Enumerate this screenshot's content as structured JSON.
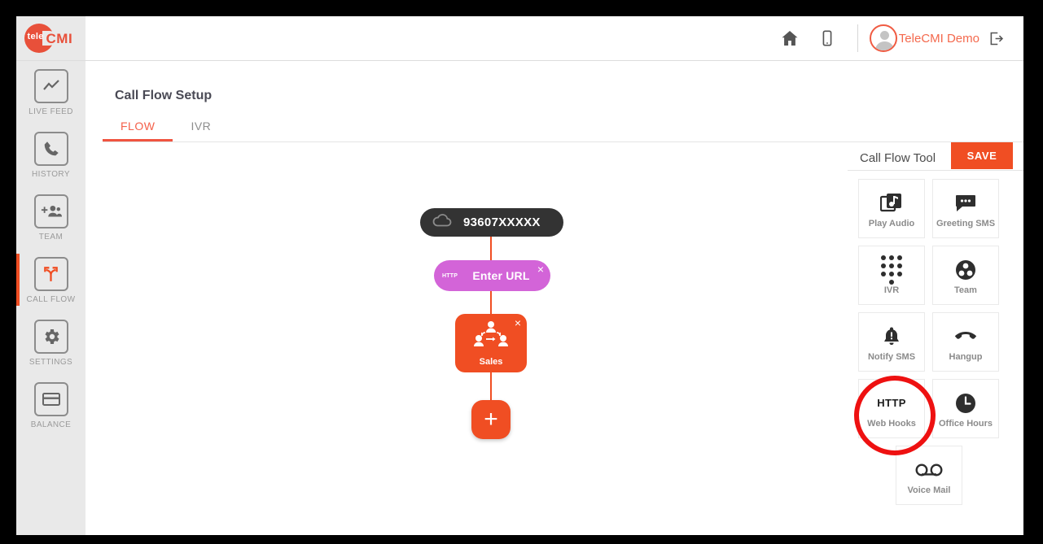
{
  "brand": {
    "logo_tele": "tele",
    "logo_cmi": "CMI",
    "accent": "#f04e23",
    "logo_red": "#e8503a"
  },
  "header": {
    "home_icon": "home-icon",
    "mobile_icon": "mobile-icon",
    "user_name": "TeleCMI Demo",
    "avatar_icon": "avatar-icon",
    "logout_icon": "logout-icon"
  },
  "sidebar": {
    "items": [
      {
        "label": "LIVE FEED",
        "icon": "line-chart-icon",
        "active": false
      },
      {
        "label": "HISTORY",
        "icon": "phone-icon",
        "active": false
      },
      {
        "label": "TEAM",
        "icon": "add-people-icon",
        "active": false
      },
      {
        "label": "CALL FLOW",
        "icon": "call-flow-branch-icon",
        "active": true
      },
      {
        "label": "SETTINGS",
        "icon": "gear-icon",
        "active": false
      },
      {
        "label": "BALANCE",
        "icon": "card-icon",
        "active": false
      }
    ]
  },
  "main": {
    "page_title": "Call Flow Setup",
    "tabs": [
      {
        "label": "FLOW",
        "active": true
      },
      {
        "label": "IVR",
        "active": false
      }
    ]
  },
  "flow": {
    "phone_node": {
      "number": "93607XXXXX",
      "icon": "cloud-icon"
    },
    "url_node": {
      "badge": "HTTP",
      "label": "Enter URL",
      "close": "×",
      "color": "#d364d8"
    },
    "sales_node": {
      "label": "Sales",
      "icon": "team-group-icon",
      "close": "×",
      "color": "#f04e23"
    },
    "add_node": {
      "label": "+"
    }
  },
  "tool_panel": {
    "title": "Call Flow Tool",
    "save_label": "SAVE",
    "tools": [
      {
        "label": "Play Audio",
        "icon": "play-audio-icon"
      },
      {
        "label": "Greeting SMS",
        "icon": "chat-bubble-icon"
      },
      {
        "label": "IVR",
        "icon": "dialpad-icon"
      },
      {
        "label": "Team",
        "icon": "team-circle-icon"
      },
      {
        "label": "Notify SMS",
        "icon": "bell-icon"
      },
      {
        "label": "Hangup",
        "icon": "hangup-icon"
      },
      {
        "label": "Web Hooks",
        "icon": "http-text-icon",
        "icon_text": "HTTP",
        "highlighted": true
      },
      {
        "label": "Office Hours",
        "icon": "clock-icon"
      },
      {
        "label": "Voice Mail",
        "icon": "voicemail-icon"
      }
    ],
    "annotation_color": "#ee1111"
  }
}
